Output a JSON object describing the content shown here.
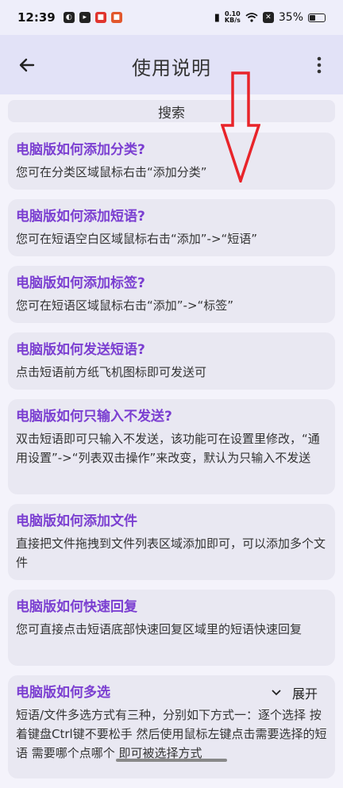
{
  "status_bar": {
    "time": "12:39",
    "net_speed_value": "0.10",
    "net_speed_unit": "KB/s",
    "battery": "35%",
    "battery_level": 0.35
  },
  "app_bar": {
    "title": "使用说明"
  },
  "search": {
    "label": "搜索"
  },
  "faq": [
    {
      "question": "电脑版如何添加分类?",
      "answer": "您可在分类区域鼠标右击“添加分类”"
    },
    {
      "question": "电脑版如何添加短语?",
      "answer": "您可在短语空白区域鼠标右击“添加”->“短语”"
    },
    {
      "question": "电脑版如何添加标签?",
      "answer": "您可在短语区域鼠标右击“添加”->“标签”"
    },
    {
      "question": "电脑版如何发送短语?",
      "answer": "点击短语前方纸飞机图标即可发送可"
    },
    {
      "question": "电脑版如何只输入不发送?",
      "answer": "双击短语即可只输入不发送，该功能可在设置里修改，“通用设置”->“列表双击操作”来改变，默认为只输入不发送"
    },
    {
      "question": "电脑版如何添加文件",
      "answer": "直接把文件拖拽到文件列表区域添加即可，可以添加多个文件"
    },
    {
      "question": "电脑版如何快速回复",
      "answer": "您可直接点击短语底部快速回复区域里的短语快速回复"
    },
    {
      "question": "电脑版如何多选",
      "answer": "短语/文件多选方式有三种，分别如下方式一：逐个选择 按着键盘Ctrl键不要松手 然后使用鼠标左键点击需要选择的短语 需要哪个点哪个 即可被选择方式",
      "expand_label": "展开"
    }
  ],
  "colors": {
    "question": "#7b3fd1",
    "card_bg": "#e9e8f2",
    "app_bar_bg": "#e2e2f7",
    "arrow": "#e8242a"
  },
  "icons": {
    "back": "arrow-left-icon",
    "more": "more-vertical-icon",
    "expand": "chevron-down-icon"
  }
}
